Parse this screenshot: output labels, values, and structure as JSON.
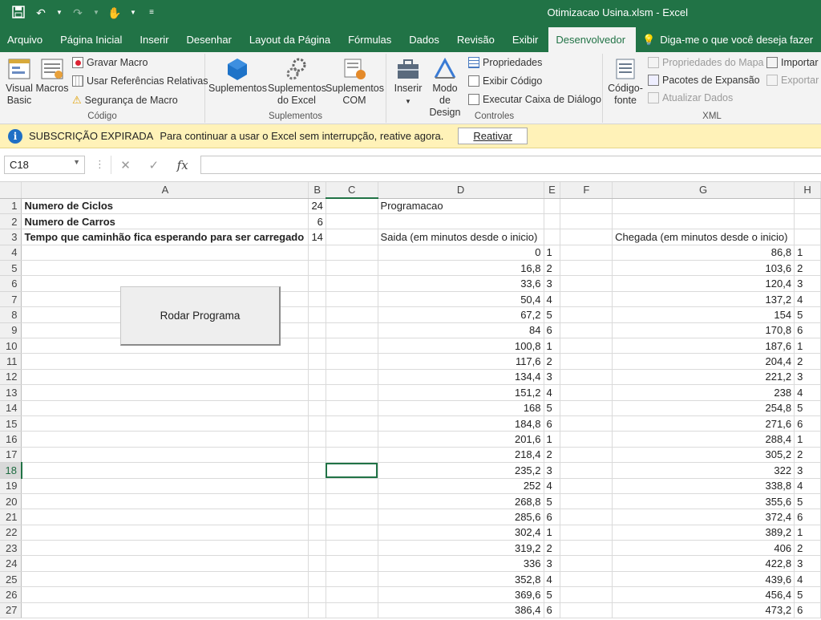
{
  "window": {
    "title": "Otimizacao Usina.xlsm  -  Excel"
  },
  "tabs": [
    "Arquivo",
    "Página Inicial",
    "Inserir",
    "Desenhar",
    "Layout da Página",
    "Fórmulas",
    "Dados",
    "Revisão",
    "Exibir",
    "Desenvolvedor"
  ],
  "active_tab": "Desenvolvedor",
  "tellme": "Diga-me o que você deseja fazer",
  "ribbon": {
    "codigo": {
      "label": "Código",
      "visual_basic": "Visual Basic",
      "visual_basic_l1": "Visual",
      "visual_basic_l2": "Basic",
      "macros": "Macros",
      "gravar": "Gravar Macro",
      "relativas": "Usar Referências Relativas",
      "seguranca": "Segurança de Macro"
    },
    "suplementos": {
      "label": "Suplementos",
      "sup": "Suplementos",
      "sup_excel_l1": "Suplementos",
      "sup_excel_l2": "do Excel",
      "sup_com_l1": "Suplementos",
      "sup_com_l2": "COM"
    },
    "controles": {
      "label": "Controles",
      "inserir": "Inserir",
      "modo_l1": "Modo de",
      "modo_l2": "Design",
      "propriedades": "Propriedades",
      "exibir_codigo": "Exibir Código",
      "executar": "Executar Caixa de Diálogo"
    },
    "xml": {
      "label": "XML",
      "codigo_l1": "Código-",
      "codigo_l2": "fonte",
      "prop_mapa": "Propriedades do Mapa",
      "pacotes": "Pacotes de Expansão",
      "atualizar": "Atualizar Dados",
      "importar": "Importar",
      "exportar": "Exportar"
    }
  },
  "message_bar": {
    "title": "SUBSCRIÇÃO EXPIRADA",
    "text": "Para continuar a usar o Excel sem interrupção, reative agora.",
    "button": "Reativar"
  },
  "formula_bar": {
    "name_box": "C18",
    "formula": ""
  },
  "columns": [
    "A",
    "B",
    "C",
    "D",
    "E",
    "F",
    "G",
    "H"
  ],
  "selected_column": "C",
  "selected_row": 18,
  "rows": [
    {
      "n": "1",
      "a": "Numero de Ciclos",
      "b": "24",
      "d": "Programacao",
      "e": "",
      "g": "",
      "h": ""
    },
    {
      "n": "2",
      "a": "Numero de Carros",
      "b": "6",
      "d": "",
      "e": "",
      "g": "",
      "h": ""
    },
    {
      "n": "3",
      "a": "Tempo que caminhão fica esperando para ser carregado",
      "b": "14",
      "d": "Saida (em minutos desde o inicio)",
      "e": "",
      "g": "Chegada (em minutos desde o inicio)",
      "h": ""
    },
    {
      "n": "4",
      "a": "",
      "b": "",
      "d": "0",
      "e": "1",
      "g": "86,8",
      "h": "1"
    },
    {
      "n": "5",
      "a": "",
      "b": "",
      "d": "16,8",
      "e": "2",
      "g": "103,6",
      "h": "2"
    },
    {
      "n": "6",
      "a": "",
      "b": "",
      "d": "33,6",
      "e": "3",
      "g": "120,4",
      "h": "3"
    },
    {
      "n": "7",
      "a": "",
      "b": "",
      "d": "50,4",
      "e": "4",
      "g": "137,2",
      "h": "4"
    },
    {
      "n": "8",
      "a": "",
      "b": "",
      "d": "67,2",
      "e": "5",
      "g": "154",
      "h": "5"
    },
    {
      "n": "9",
      "a": "",
      "b": "",
      "d": "84",
      "e": "6",
      "g": "170,8",
      "h": "6"
    },
    {
      "n": "10",
      "a": "",
      "b": "",
      "d": "100,8",
      "e": "1",
      "g": "187,6",
      "h": "1"
    },
    {
      "n": "11",
      "a": "",
      "b": "",
      "d": "117,6",
      "e": "2",
      "g": "204,4",
      "h": "2"
    },
    {
      "n": "12",
      "a": "",
      "b": "",
      "d": "134,4",
      "e": "3",
      "g": "221,2",
      "h": "3"
    },
    {
      "n": "13",
      "a": "",
      "b": "",
      "d": "151,2",
      "e": "4",
      "g": "238",
      "h": "4"
    },
    {
      "n": "14",
      "a": "",
      "b": "",
      "d": "168",
      "e": "5",
      "g": "254,8",
      "h": "5"
    },
    {
      "n": "15",
      "a": "",
      "b": "",
      "d": "184,8",
      "e": "6",
      "g": "271,6",
      "h": "6"
    },
    {
      "n": "16",
      "a": "",
      "b": "",
      "d": "201,6",
      "e": "1",
      "g": "288,4",
      "h": "1"
    },
    {
      "n": "17",
      "a": "",
      "b": "",
      "d": "218,4",
      "e": "2",
      "g": "305,2",
      "h": "2"
    },
    {
      "n": "18",
      "a": "",
      "b": "",
      "d": "235,2",
      "e": "3",
      "g": "322",
      "h": "3"
    },
    {
      "n": "19",
      "a": "",
      "b": "",
      "d": "252",
      "e": "4",
      "g": "338,8",
      "h": "4"
    },
    {
      "n": "20",
      "a": "",
      "b": "",
      "d": "268,8",
      "e": "5",
      "g": "355,6",
      "h": "5"
    },
    {
      "n": "21",
      "a": "",
      "b": "",
      "d": "285,6",
      "e": "6",
      "g": "372,4",
      "h": "6"
    },
    {
      "n": "22",
      "a": "",
      "b": "",
      "d": "302,4",
      "e": "1",
      "g": "389,2",
      "h": "1"
    },
    {
      "n": "23",
      "a": "",
      "b": "",
      "d": "319,2",
      "e": "2",
      "g": "406",
      "h": "2"
    },
    {
      "n": "24",
      "a": "",
      "b": "",
      "d": "336",
      "e": "3",
      "g": "422,8",
      "h": "3"
    },
    {
      "n": "25",
      "a": "",
      "b": "",
      "d": "352,8",
      "e": "4",
      "g": "439,6",
      "h": "4"
    },
    {
      "n": "26",
      "a": "",
      "b": "",
      "d": "369,6",
      "e": "5",
      "g": "456,4",
      "h": "5"
    },
    {
      "n": "27",
      "a": "",
      "b": "",
      "d": "386,4",
      "e": "6",
      "g": "473,2",
      "h": "6"
    }
  ],
  "form_button": {
    "label": "Rodar Programa"
  },
  "colors": {
    "excel_green": "#217346",
    "message_bar": "#fff2b8"
  }
}
